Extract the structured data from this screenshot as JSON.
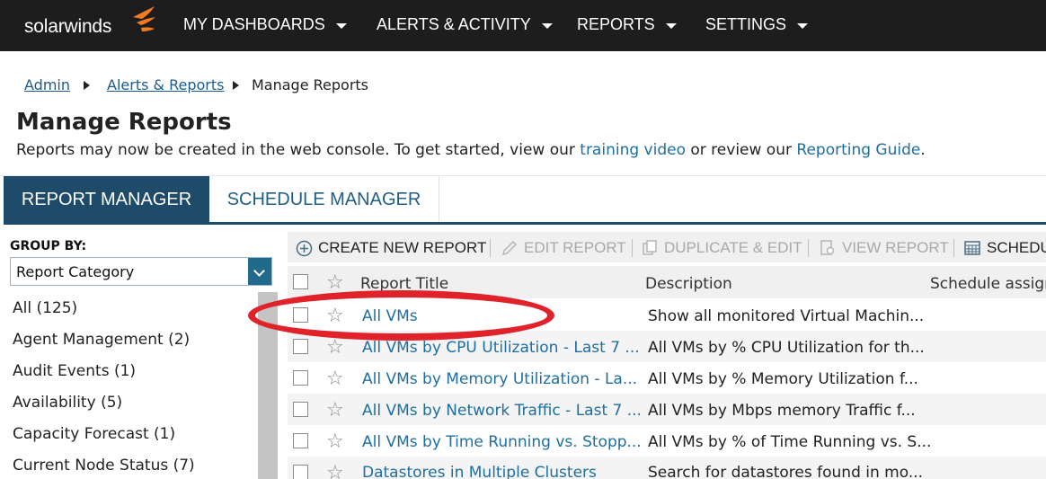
{
  "nav": {
    "logo_text": "solarwinds",
    "brand_color": "#f47b20",
    "items": [
      {
        "label": "MY DASHBOARDS"
      },
      {
        "label": "ALERTS & ACTIVITY"
      },
      {
        "label": "REPORTS"
      },
      {
        "label": "SETTINGS"
      }
    ]
  },
  "breadcrumb": {
    "items": [
      {
        "label": "Admin"
      },
      {
        "label": "Alerts & Reports"
      },
      {
        "label": "Manage Reports"
      }
    ]
  },
  "page": {
    "title": "Manage Reports",
    "intro_prefix": "Reports may now be created in the web console. To get started, view our",
    "training_link": "training video",
    "intro_middle": "or review our",
    "guide_link": "Reporting Guide",
    "intro_suffix": "."
  },
  "tabs": [
    {
      "label": "REPORT MANAGER",
      "active": true
    },
    {
      "label": "SCHEDULE MANAGER",
      "active": false
    }
  ],
  "sidebar": {
    "group_by_label": "GROUP BY:",
    "group_by_value": "Report Category",
    "categories": [
      {
        "label": "All (125)"
      },
      {
        "label": "Agent Management (2)"
      },
      {
        "label": "Audit Events (1)"
      },
      {
        "label": "Availability (5)"
      },
      {
        "label": "Capacity Forecast (1)"
      },
      {
        "label": "Current Node Status (7)"
      }
    ]
  },
  "toolbar": {
    "create": "CREATE NEW REPORT",
    "edit": "EDIT REPORT",
    "duplicate": "DUPLICATE & EDIT",
    "view": "VIEW REPORT",
    "schedule": "SCHEDU"
  },
  "grid": {
    "columns": {
      "title": "Report Title",
      "description": "Description",
      "schedule": "Schedule assign"
    },
    "rows": [
      {
        "title": "All VMs",
        "description": "Show all monitored Virtual Machin..."
      },
      {
        "title": "All VMs by CPU Utilization - Last 7 ...",
        "description": "All VMs by % CPU Utilization for th..."
      },
      {
        "title": "All VMs by Memory Utilization - La...",
        "description": "All VMs by % Memory Utilization f..."
      },
      {
        "title": "All VMs by Network Traffic - Last 7 ...",
        "description": "All VMs by Mbps memory Traffic f..."
      },
      {
        "title": "All VMs by Time Running vs. Stopp...",
        "description": "All VMs by % of Time Running vs. S..."
      },
      {
        "title": "Datastores in Multiple Clusters",
        "description": "Search for datastores found in mo..."
      }
    ]
  },
  "annotation_color": "#e0222a"
}
